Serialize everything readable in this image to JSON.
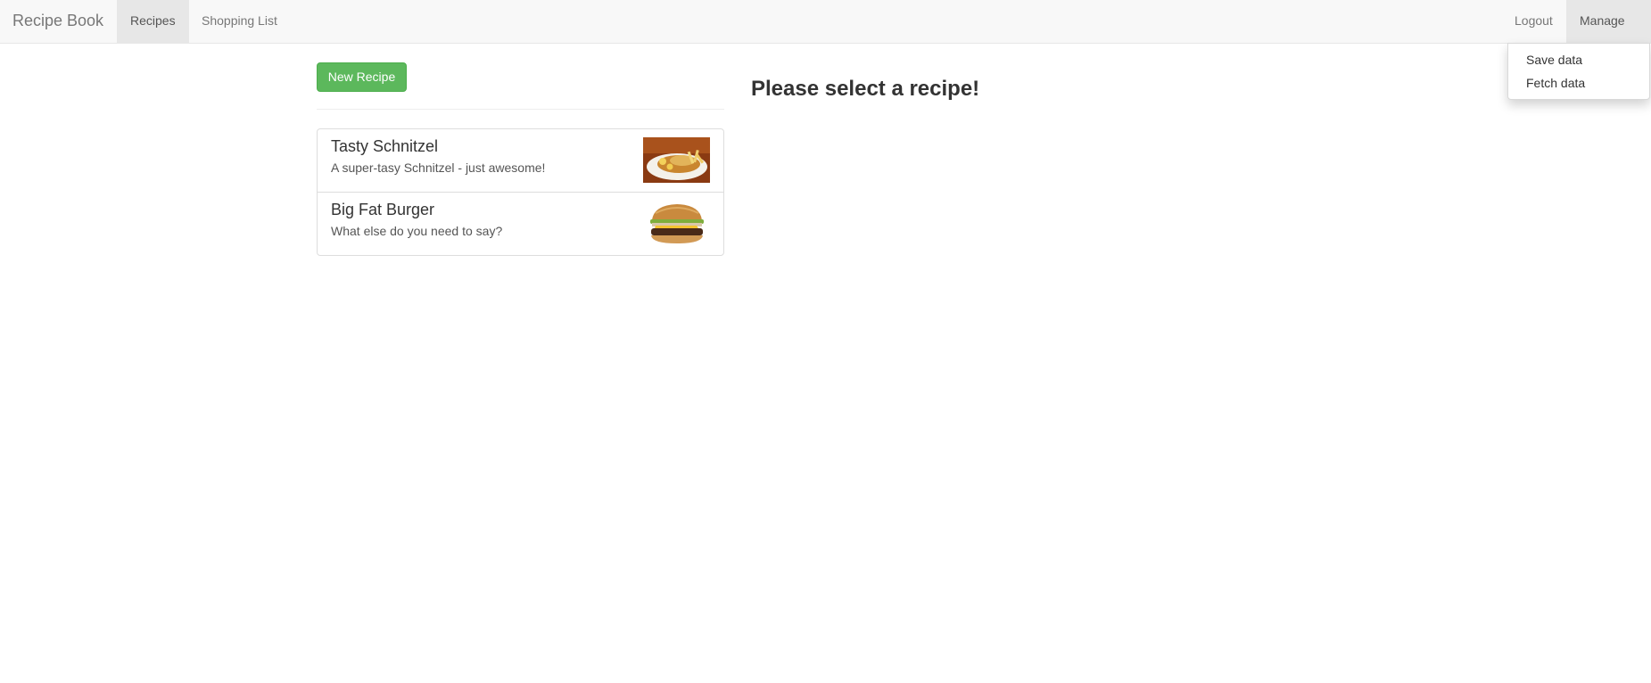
{
  "navbar": {
    "brand": "Recipe Book",
    "items": [
      {
        "label": "Recipes",
        "active": true
      },
      {
        "label": "Shopping List",
        "active": false
      }
    ],
    "logout_label": "Logout",
    "manage_label": "Manage",
    "manage_dropdown": {
      "open": true,
      "items": [
        {
          "label": "Save data"
        },
        {
          "label": "Fetch data"
        }
      ]
    }
  },
  "recipes": {
    "new_button_label": "New Recipe",
    "list": [
      {
        "name": "Tasty Schnitzel",
        "description": "A super-tasy Schnitzel - just awesome!",
        "image": "schnitzel-photo"
      },
      {
        "name": "Big Fat Burger",
        "description": "What else do you need to say?",
        "image": "burger-photo"
      }
    ]
  },
  "detail": {
    "placeholder": "Please select a recipe!"
  },
  "colors": {
    "success": "#5cb85c",
    "navbar_bg": "#f8f8f8",
    "active_bg": "#e7e7e7"
  }
}
